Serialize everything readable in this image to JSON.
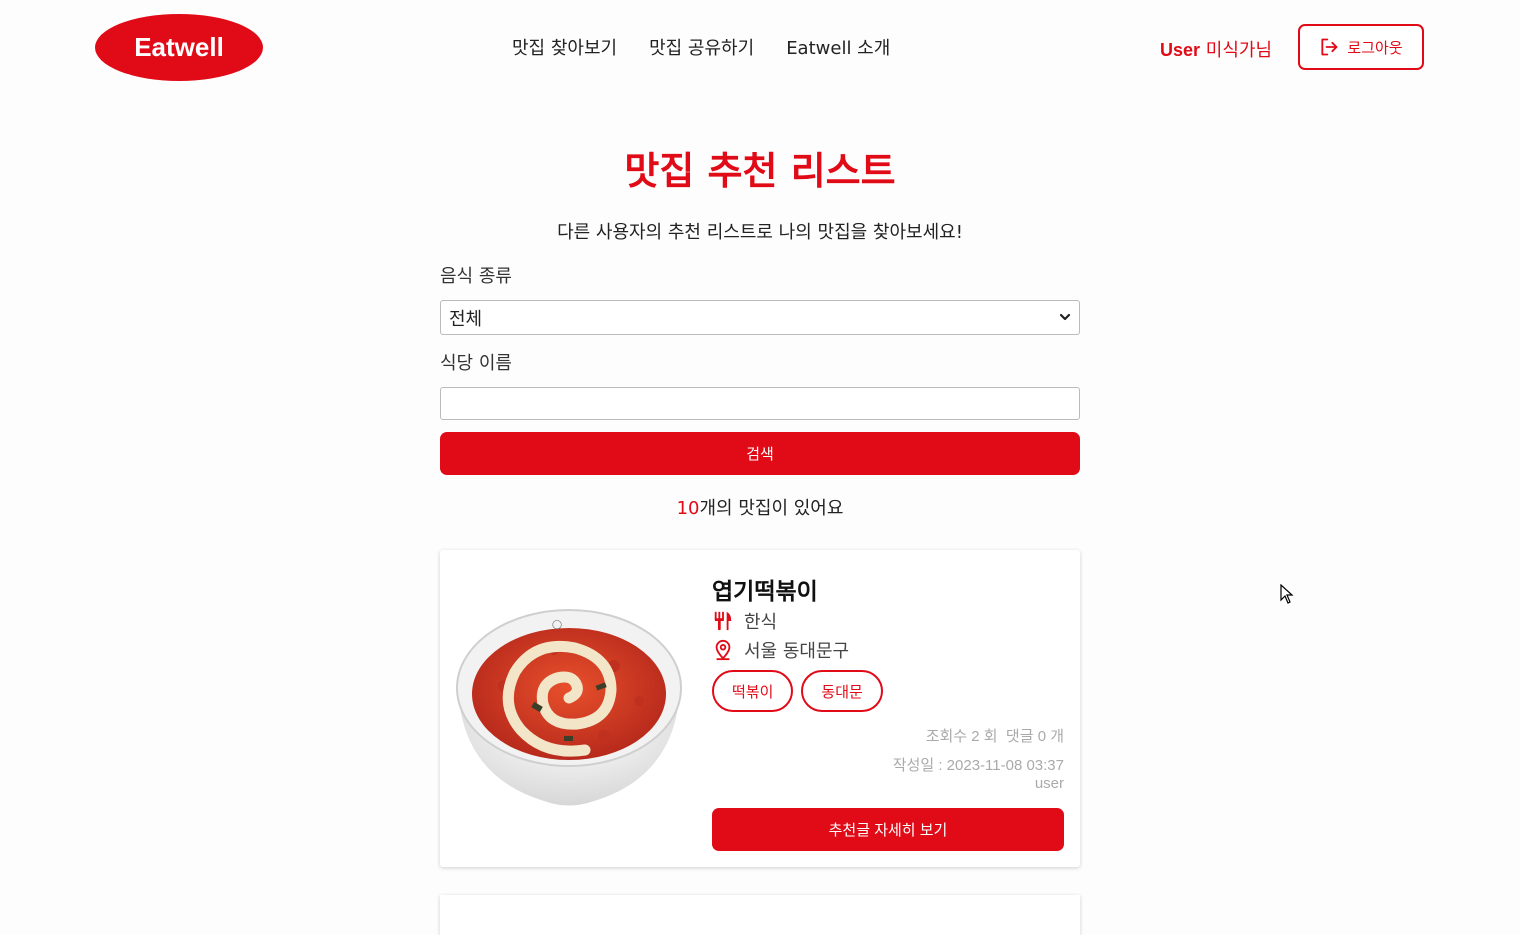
{
  "header": {
    "logo": "Eatwell",
    "nav": [
      "맛집 찾아보기",
      "맛집 공유하기",
      "Eatwell 소개"
    ],
    "user_bold": "User",
    "user_name": "미식가님",
    "logout": "로그아웃"
  },
  "main": {
    "title": "맛집 추천 리스트",
    "subtitle": "다른 사용자의 추천 리스트로 나의 맛집을 찾아보세요!",
    "food_type_label": "음식 종류",
    "food_type_value": "전체",
    "restaurant_name_label": "식당 이름",
    "restaurant_name_value": "",
    "search_button": "검색",
    "count_num": "10",
    "count_text": "개의 맛집이 있어요"
  },
  "cards": [
    {
      "name": "엽기떡볶이",
      "category": "한식",
      "location": "서울 동대문구",
      "tags": [
        "떡볶이",
        "동대문"
      ],
      "views": "조회수 2 회",
      "comments": "댓글 0 개",
      "date": "작성일 : 2023-11-08 03:37",
      "author": "user",
      "detail_button": "추천글 자세히 보기"
    }
  ],
  "colors": {
    "accent": "#e10a17"
  }
}
